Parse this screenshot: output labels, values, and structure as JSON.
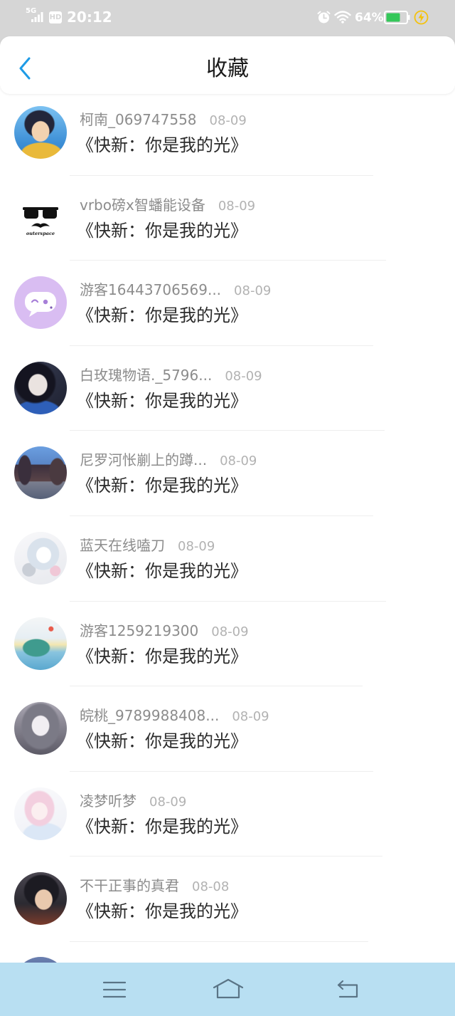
{
  "status_bar": {
    "network": "5G",
    "hd": "HD",
    "time": "20:12",
    "battery_level": "64%",
    "icons": [
      "signal-icon",
      "hd-badge",
      "alarm-icon",
      "wifi-icon",
      "battery-icon",
      "charging-icon"
    ]
  },
  "header": {
    "title": "收藏",
    "back_icon": "chevron-left-icon"
  },
  "favorites": [
    {
      "name": "柯南_069747558",
      "date": "08-09",
      "content": "《快新：你是我的光》"
    },
    {
      "name": "vrbo磅x智蟠能设备",
      "date": "08-09",
      "content": "《快新：你是我的光》",
      "avatar_text": "outerspace"
    },
    {
      "name": "游客16443706569...",
      "date": "08-09",
      "content": "《快新：你是我的光》"
    },
    {
      "name": "白玫瑰物语._5796...",
      "date": "08-09",
      "content": "《快新：你是我的光》"
    },
    {
      "name": "尼罗河怅剻上的蹲...",
      "date": "08-09",
      "content": "《快新：你是我的光》"
    },
    {
      "name": "蓝天在线嗑刀",
      "date": "08-09",
      "content": "《快新：你是我的光》"
    },
    {
      "name": "游客1259219300",
      "date": "08-09",
      "content": "《快新：你是我的光》"
    },
    {
      "name": "皖桃_9789988408...",
      "date": "08-09",
      "content": "《快新：你是我的光》"
    },
    {
      "name": "凌梦听梦",
      "date": "08-09",
      "content": "《快新：你是我的光》"
    },
    {
      "name": "不干正事的真君",
      "date": "08-08",
      "content": "《快新：你是我的光》"
    }
  ],
  "nav_bar": {
    "icons": [
      "menu-icon",
      "home-icon",
      "back-icon"
    ]
  },
  "colors": {
    "accent": "#1e9be6",
    "status_bar_bg": "#d6d6d6",
    "nav_bar_bg": "#b8dff2",
    "battery_fill": "#34c759",
    "charging": "#f4c20d"
  }
}
